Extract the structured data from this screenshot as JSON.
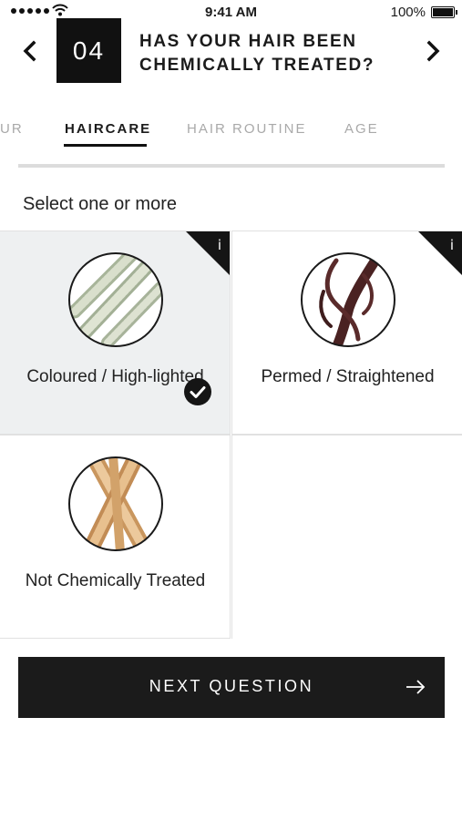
{
  "status_bar": {
    "time": "9:41 AM",
    "battery": "100%"
  },
  "header": {
    "question_number": "04",
    "title": "HAS YOUR HAIR BEEN CHEMICALLY TREATED?"
  },
  "tabs": [
    {
      "label": "UR",
      "active": false
    },
    {
      "label": "HAIRCARE",
      "active": true
    },
    {
      "label": "HAIR ROUTINE",
      "active": false
    },
    {
      "label": "AGE",
      "active": false
    }
  ],
  "instruction": "Select one or more",
  "options": [
    {
      "label": "Coloured / High-lighted",
      "selected": true,
      "icon": "coloured-hair-thumbnail",
      "info": "i"
    },
    {
      "label": "Permed / Straightened",
      "selected": false,
      "icon": "permed-hair-thumbnail",
      "info": "i"
    },
    {
      "label": "Not Chemically Treated",
      "selected": false,
      "icon": "natural-hair-thumbnail"
    }
  ],
  "next_button": {
    "label": "NEXT QUESTION",
    "icon": "arrow-right-icon"
  },
  "colors": {
    "primary": "#1b1b1b",
    "selected_bg": "#eef0f1",
    "muted": "#a9a9a9"
  }
}
